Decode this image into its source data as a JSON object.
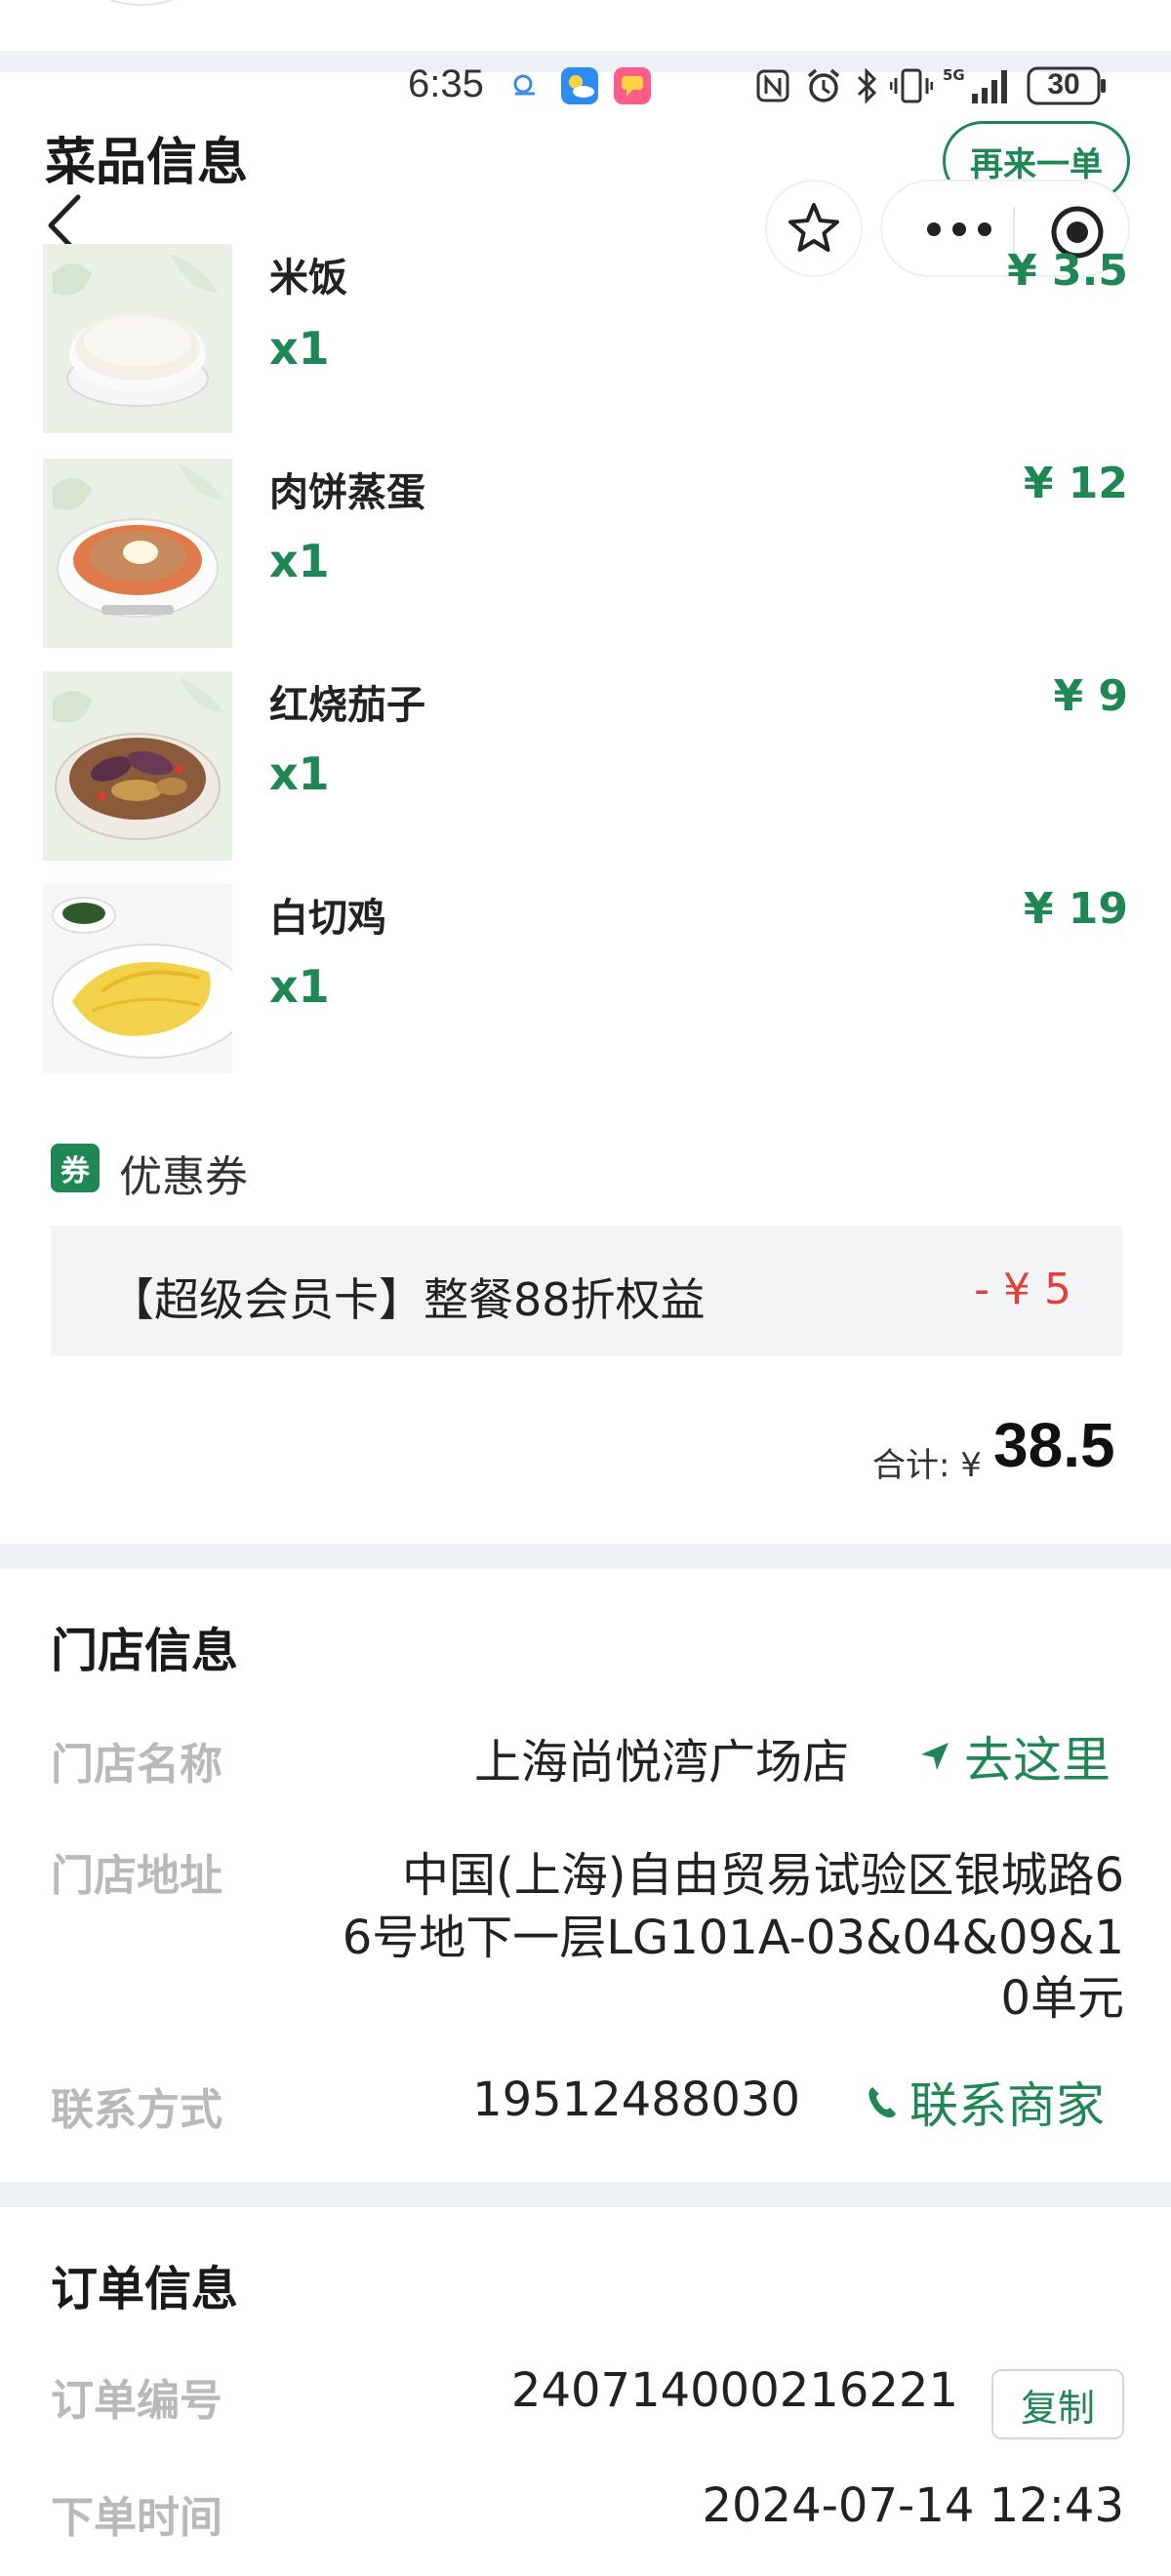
{
  "status_bar": {
    "time": "6:35",
    "battery": "30"
  },
  "nav": {
    "back_icon": "chevron-left-icon",
    "reorder_label": "再来一单",
    "favorite_icon": "star-icon",
    "more_icon": "more-dots-icon",
    "close_icon": "target-circle-icon"
  },
  "dishes_section": {
    "title": "菜品信息",
    "items": [
      {
        "name": "米饭",
        "qty": "x1",
        "price": "¥ 3.5",
        "image": "rice-bowl"
      },
      {
        "name": "肉饼蒸蛋",
        "qty": "x1",
        "price": "¥ 12",
        "image": "steamed-egg-pork"
      },
      {
        "name": "红烧茄子",
        "qty": "x1",
        "price": "¥ 9",
        "image": "braised-eggplant"
      },
      {
        "name": "白切鸡",
        "qty": "x1",
        "price": "¥ 19",
        "image": "white-cut-chicken"
      }
    ]
  },
  "coupon": {
    "badge": "券",
    "label": "优惠券",
    "name": "【超级会员卡】整餐88折权益",
    "amount": "- ¥ 5"
  },
  "total": {
    "label": "合计: ¥",
    "value": "38.5"
  },
  "store_section": {
    "title": "门店信息",
    "name_label": "门店名称",
    "name_value": "上海尚悦湾广场店",
    "navigate_label": "去这里",
    "address_label": "门店地址",
    "address_lines": [
      "中国(上海)自由贸易试验区银城路6",
      "6号地下一层LG101A-03&04&09&1",
      "0单元"
    ],
    "contact_label": "联系方式",
    "contact_value": "19512488030",
    "contact_link": "联系商家"
  },
  "order_section": {
    "title": "订单信息",
    "number_label": "订单编号",
    "number_value": "240714000216221",
    "copy_label": "复制",
    "time_label": "下单时间",
    "time_value": "2024-07-14 12:43"
  },
  "colors": {
    "brand_green": "#1e8754",
    "discount_red": "#e0403c",
    "band_gray": "#edf1f4"
  }
}
